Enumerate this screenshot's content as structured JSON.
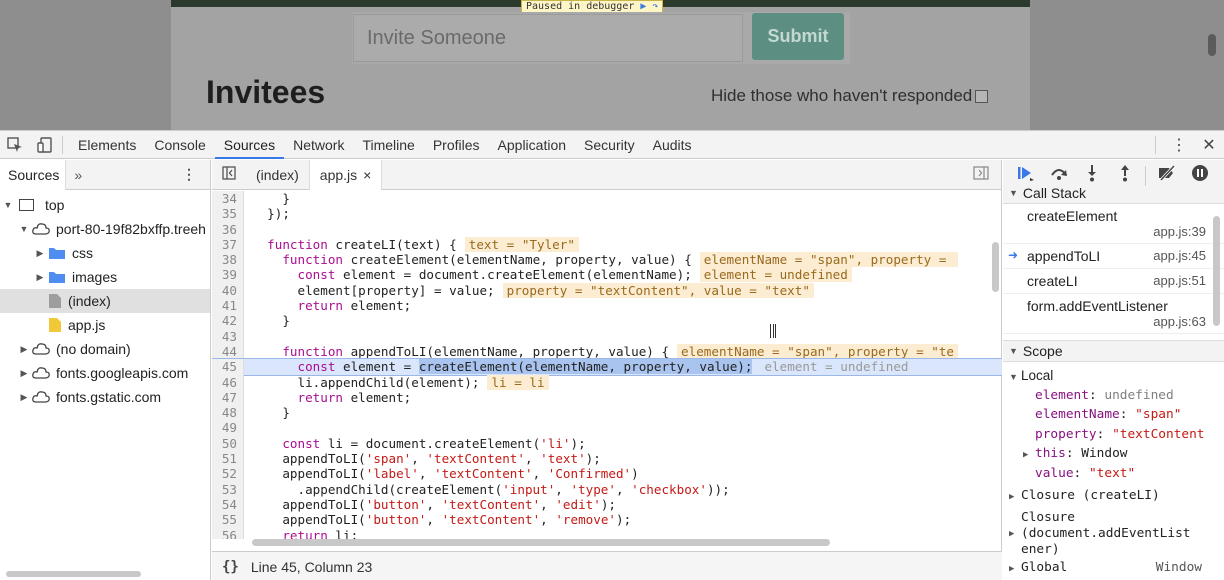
{
  "page": {
    "paused_label": "Paused in debugger",
    "invite_placeholder": "Invite Someone",
    "submit_label": "Submit",
    "invitees_title": "Invitees",
    "hide_label": "Hide those who haven't responded"
  },
  "devtools": {
    "tabs": [
      "Elements",
      "Console",
      "Sources",
      "Network",
      "Timeline",
      "Profiles",
      "Application",
      "Security",
      "Audits"
    ],
    "active_tab": "Sources",
    "accent_color": "#3b78e7"
  },
  "navigator": {
    "tab_label": "Sources",
    "more_label": "»",
    "tree": [
      {
        "label": "top",
        "icon": "frame-icon",
        "depth": 0,
        "arrow": "down"
      },
      {
        "label": "port-80-19f82bxffp.treeh",
        "icon": "cloud-icon",
        "depth": 1,
        "arrow": "down"
      },
      {
        "label": "css",
        "icon": "folder-icon",
        "depth": 2,
        "arrow": "right"
      },
      {
        "label": "images",
        "icon": "folder-icon",
        "depth": 2,
        "arrow": "right"
      },
      {
        "label": "(index)",
        "icon": "file-icon",
        "depth": 2,
        "arrow": "none",
        "selected": true
      },
      {
        "label": "app.js",
        "icon": "js-file-icon",
        "depth": 2,
        "arrow": "none"
      },
      {
        "label": "(no domain)",
        "icon": "cloud-icon",
        "depth": 1,
        "arrow": "right"
      },
      {
        "label": "fonts.googleapis.com",
        "icon": "cloud-icon",
        "depth": 1,
        "arrow": "right"
      },
      {
        "label": "fonts.gstatic.com",
        "icon": "cloud-icon",
        "depth": 1,
        "arrow": "right"
      }
    ]
  },
  "editor": {
    "tabs": [
      {
        "label": "(index)",
        "active": false
      },
      {
        "label": "app.js",
        "active": true,
        "close": "×"
      }
    ],
    "status": "Line 45, Column 23",
    "status_braces": "{}",
    "lines": [
      {
        "n": "34",
        "code": "    }"
      },
      {
        "n": "35",
        "code": "  });"
      },
      {
        "n": "36",
        "code": ""
      },
      {
        "n": "37",
        "code": "  function createLI(text) {",
        "inline": "text = \"Tyler\""
      },
      {
        "n": "38",
        "code": "    function createElement(elementName, property, value) {",
        "inline": "elementName = \"span\", property = "
      },
      {
        "n": "39",
        "code": "      const element = document.createElement(elementName);",
        "inline": "element = undefined"
      },
      {
        "n": "40",
        "code": "      element[property] = value;",
        "inline": "property = \"textContent\", value = \"text\""
      },
      {
        "n": "41",
        "code": "      return element;"
      },
      {
        "n": "42",
        "code": "    }"
      },
      {
        "n": "43",
        "code": ""
      },
      {
        "n": "44",
        "code": "    function appendToLI(elementName, property, value) {",
        "inline": "elementName = \"span\", property = \"te"
      },
      {
        "n": "45",
        "pre": "      const element = ",
        "hl": "createElement(elementName, property, value);",
        "inline": "element = undefined",
        "exec": true
      },
      {
        "n": "46",
        "code": "      li.appendChild(element);",
        "inline": "li = li"
      },
      {
        "n": "47",
        "code": "      return element;"
      },
      {
        "n": "48",
        "code": "    }"
      },
      {
        "n": "49",
        "code": ""
      },
      {
        "n": "50",
        "code": "    const li = document.createElement('li');"
      },
      {
        "n": "51",
        "code": "    appendToLI('span', 'textContent', 'text');"
      },
      {
        "n": "52",
        "code": "    appendToLI('label', 'textContent', 'Confirmed')"
      },
      {
        "n": "53",
        "code": "      .appendChild(createElement('input', 'type', 'checkbox'));"
      },
      {
        "n": "54",
        "code": "    appendToLI('button', 'textContent', 'edit');"
      },
      {
        "n": "55",
        "code": "    appendToLI('button', 'textContent', 'remove');"
      },
      {
        "n": "56",
        "code": "    return li;"
      }
    ]
  },
  "debugger": {
    "call_stack_title": "Call Stack",
    "frames": [
      {
        "name": "createElement",
        "loc": "app.js:39",
        "two_line": true,
        "current": false
      },
      {
        "name": "appendToLI",
        "loc": "app.js:45",
        "two_line": false,
        "current": true
      },
      {
        "name": "createLI",
        "loc": "app.js:51",
        "two_line": false,
        "current": false
      },
      {
        "name": "form.addEventListener",
        "loc": "app.js:63",
        "two_line": true,
        "current": false
      }
    ],
    "scope_title": "Scope",
    "local_label": "Local",
    "vars": [
      {
        "key": "element",
        "value": "undefined",
        "kind": "undefined",
        "expandable": false
      },
      {
        "key": "elementName",
        "value": "\"span\"",
        "kind": "string",
        "expandable": false
      },
      {
        "key": "property",
        "value": "\"textContent",
        "kind": "string",
        "expandable": false
      },
      {
        "key": "this",
        "value": "Window",
        "kind": "object",
        "expandable": true
      },
      {
        "key": "value",
        "value": "\"text\"",
        "kind": "string",
        "expandable": false
      }
    ],
    "closure_1": "Closure (createLI)",
    "closure_2_a": "Closure",
    "closure_2_b": "(document.addEventList",
    "closure_2_c": "ener)",
    "global_label": "Global",
    "global_value": "Window"
  }
}
